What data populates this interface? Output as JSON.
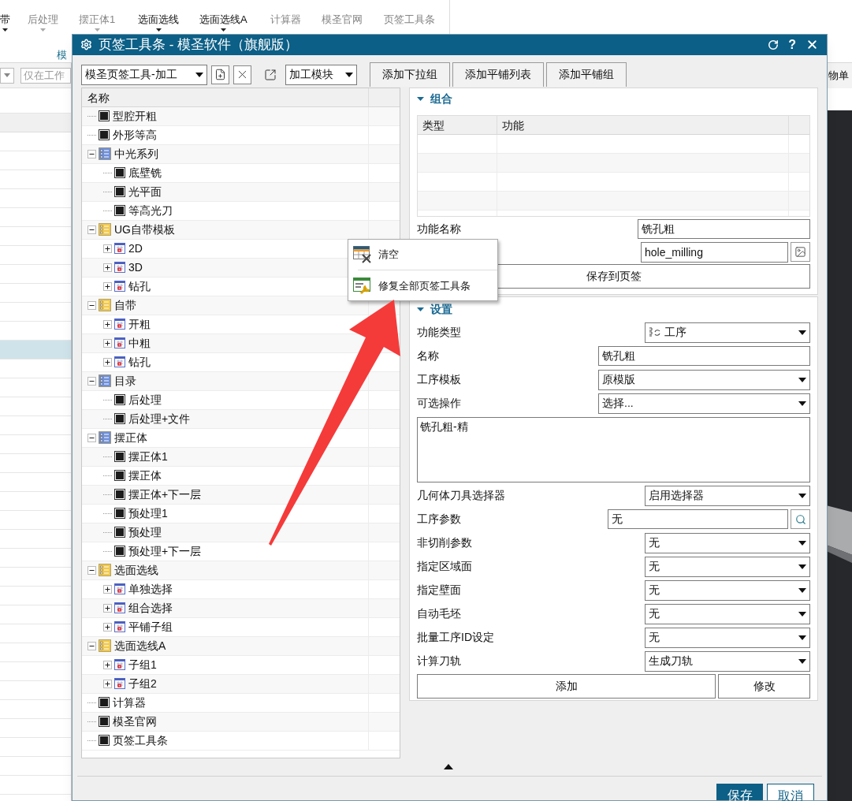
{
  "app": {
    "ribbon": [
      {
        "label": "带",
        "disabled": false,
        "has_menu": true
      },
      {
        "label": "后处理",
        "disabled": true,
        "has_menu": true
      },
      {
        "label": "摆正体1",
        "disabled": true,
        "has_menu": true
      },
      {
        "label": "选面选线",
        "disabled": false,
        "has_menu": true
      },
      {
        "label": "选面选线A",
        "disabled": false,
        "has_menu": true
      },
      {
        "label": "计算器",
        "disabled": true,
        "has_menu": false
      },
      {
        "label": "模圣官网",
        "disabled": true,
        "has_menu": false
      },
      {
        "label": "页签工具条",
        "disabled": true,
        "has_menu": false
      }
    ],
    "group_label": "模",
    "filter_field": "仅在工作",
    "right_text": "物单",
    "list_rows": [
      {
        "selected": false
      },
      {
        "selected": false
      },
      {
        "selected": false
      },
      {
        "selected": false
      },
      {
        "selected": false
      },
      {
        "selected": false
      },
      {
        "selected": false
      },
      {
        "selected": false
      },
      {
        "selected": false
      },
      {
        "selected": false
      },
      {
        "selected": false
      },
      {
        "selected": true
      },
      {
        "selected": false
      },
      {
        "selected": false
      },
      {
        "selected": false
      },
      {
        "selected": false
      },
      {
        "selected": false
      },
      {
        "selected": false
      },
      {
        "selected": false
      },
      {
        "selected": false
      },
      {
        "selected": false
      },
      {
        "selected": false
      },
      {
        "selected": false
      },
      {
        "selected": false
      },
      {
        "selected": false
      },
      {
        "selected": false
      },
      {
        "selected": false
      },
      {
        "selected": false
      },
      {
        "selected": false
      },
      {
        "selected": false
      },
      {
        "selected": false
      },
      {
        "selected": false
      },
      {
        "selected": false
      },
      {
        "selected": false
      },
      {
        "selected": false
      }
    ]
  },
  "dialog": {
    "title": "页签工具条 - 模圣软件（旗舰版）",
    "help_label": "?",
    "toolbar": {
      "toolbar_select": "模圣页签工具-加工",
      "module_select": "加工模块",
      "tab_buttons": [
        "添加下拉组",
        "添加平铺列表",
        "添加平铺组"
      ]
    },
    "tree": {
      "header": "名称",
      "items": [
        {
          "label": "型腔开粗",
          "kind": "operation"
        },
        {
          "label": "外形等高",
          "kind": "operation"
        },
        {
          "label": "中光系列",
          "kind": "list",
          "color": "#6f8fd8",
          "expanded": true,
          "children": [
            {
              "label": "底壁铣",
              "kind": "operation"
            },
            {
              "label": "光平面",
              "kind": "operation"
            },
            {
              "label": "等高光刀",
              "kind": "operation"
            }
          ]
        },
        {
          "label": "UG自带模板",
          "kind": "list",
          "color": "#f2c94c",
          "expanded": true,
          "children": [
            {
              "label": "2D",
              "kind": "group",
              "expanded": false
            },
            {
              "label": "3D",
              "kind": "group",
              "expanded": false
            },
            {
              "label": "钻孔",
              "kind": "group",
              "expanded": false
            }
          ]
        },
        {
          "label": "自带",
          "kind": "list",
          "color": "#f2c94c",
          "expanded": true,
          "children": [
            {
              "label": "开粗",
              "kind": "group",
              "expanded": false
            },
            {
              "label": "中粗",
              "kind": "group",
              "expanded": false
            },
            {
              "label": "钻孔",
              "kind": "group",
              "expanded": false
            }
          ]
        },
        {
          "label": "目录",
          "kind": "list",
          "color": "#6f8fd8",
          "expanded": true,
          "children": [
            {
              "label": "后处理",
              "kind": "operation"
            },
            {
              "label": "后处理+文件",
              "kind": "operation"
            }
          ]
        },
        {
          "label": "摆正体",
          "kind": "list",
          "color": "#6f8fd8",
          "expanded": true,
          "children": [
            {
              "label": "摆正体1",
              "kind": "operation"
            },
            {
              "label": "摆正体",
              "kind": "operation"
            },
            {
              "label": "摆正体+下一层",
              "kind": "operation"
            },
            {
              "label": "预处理1",
              "kind": "operation"
            },
            {
              "label": "预处理",
              "kind": "operation"
            },
            {
              "label": "预处理+下一层",
              "kind": "operation"
            }
          ]
        },
        {
          "label": "选面选线",
          "kind": "list",
          "color": "#f2c94c",
          "expanded": true,
          "children": [
            {
              "label": "单独选择",
              "kind": "group",
              "expanded": false
            },
            {
              "label": "组合选择",
              "kind": "group",
              "expanded": false
            },
            {
              "label": "平铺子组",
              "kind": "group",
              "expanded": false
            }
          ]
        },
        {
          "label": "选面选线A",
          "kind": "list",
          "color": "#f2c94c",
          "expanded": true,
          "children": [
            {
              "label": "子组1",
              "kind": "group",
              "expanded": false
            },
            {
              "label": "子组2",
              "kind": "group",
              "expanded": false
            }
          ]
        },
        {
          "label": "计算器",
          "kind": "operation"
        },
        {
          "label": "模圣官网",
          "kind": "operation"
        },
        {
          "label": "页签工具条",
          "kind": "operation"
        }
      ]
    },
    "combo": {
      "title": "组合",
      "expanded": true,
      "columns": [
        "类型",
        "功能"
      ],
      "function_name_label": "功能名称",
      "function_name": "铣孔粗",
      "icon_name": "hole_milling",
      "save_button": "保存到页签"
    },
    "settings": {
      "title": "设置",
      "expanded": true,
      "fields": [
        {
          "label": "功能类型",
          "kind": "type-dropdown",
          "value": "工序"
        },
        {
          "label": "名称",
          "kind": "text",
          "value": "铣孔粗"
        },
        {
          "label": "工序模板",
          "kind": "dropdown",
          "value": "原模版"
        },
        {
          "label": "可选操作",
          "kind": "dropdown",
          "value": "选择..."
        },
        {
          "kind": "textarea",
          "value": "铣孔粗-精"
        },
        {
          "label": "几何体刀具选择器",
          "kind": "dropdown",
          "value": "启用选择器"
        },
        {
          "label": "工序参数",
          "kind": "search",
          "value": "无"
        },
        {
          "label": "非切削参数",
          "kind": "dropdown",
          "value": "无"
        },
        {
          "label": "指定区域面",
          "kind": "dropdown",
          "value": "无"
        },
        {
          "label": "指定壁面",
          "kind": "dropdown",
          "value": "无"
        },
        {
          "label": "自动毛坯",
          "kind": "dropdown",
          "value": "无"
        },
        {
          "label": "批量工序ID设定",
          "kind": "dropdown",
          "value": "无"
        },
        {
          "label": "计算刀轨",
          "kind": "dropdown",
          "value": "生成刀轨"
        }
      ],
      "add_button": "添加",
      "modify_button": "修改"
    },
    "footer": {
      "save": "保存",
      "cancel": "取消"
    }
  },
  "context_menu": [
    {
      "label": "清空",
      "kind": "clear"
    },
    {
      "label": "修复全部页签工具条",
      "kind": "repair"
    }
  ]
}
